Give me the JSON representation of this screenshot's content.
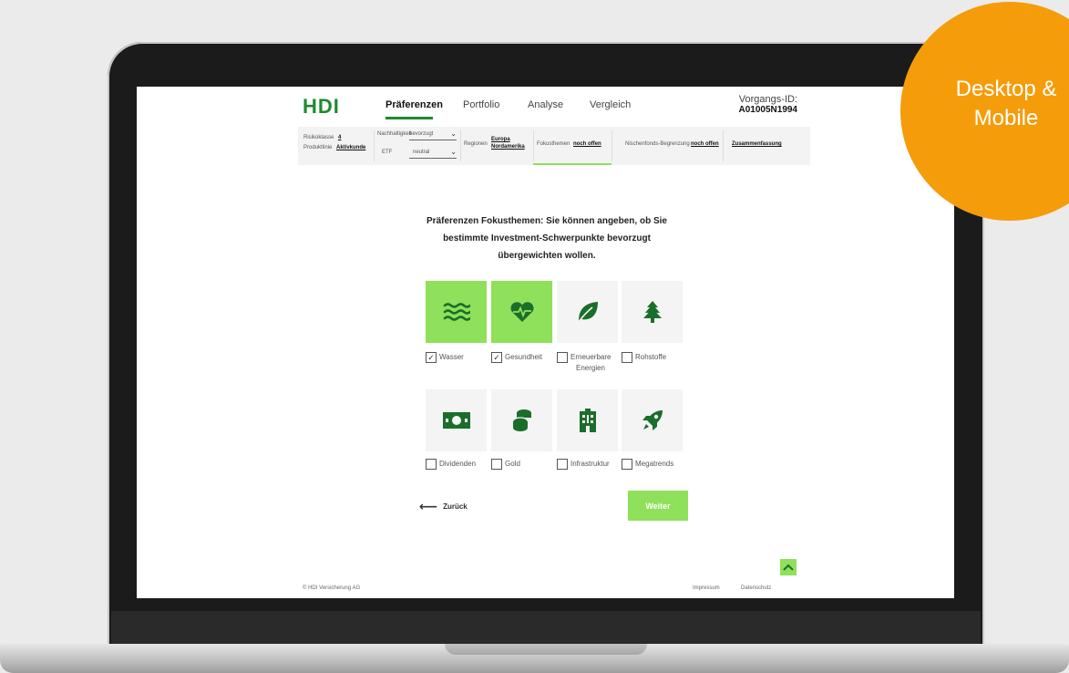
{
  "header": {
    "logo": "HDI",
    "nav": [
      "Präferenzen",
      "Portfolio",
      "Analyse",
      "Vergleich"
    ],
    "vorgang_label": "Vorgangs-ID:",
    "vorgang_id": "A01005N1994"
  },
  "filter_bar": {
    "risikoklasse_label": "Risikoklasse",
    "risikoklasse_value": "4",
    "produktlinie_label": "Produktlinie",
    "produktlinie_value": "Aktivkunde",
    "nachhaltigkeit_label": "Nachhaltigkeit",
    "nachhaltigkeit_value": "bevorzugt",
    "etf_label": "ETF",
    "etf_value": "neutral",
    "regionen_label": "Regionen",
    "regionen_value_1": "Europa",
    "regionen_value_2": "Nordamerika",
    "fokusthemen_label": "Fokusthemen",
    "fokusthemen_value": "noch offen",
    "nischenfonds_label": "Nischenfonds-Begrenzung",
    "nischenfonds_value": "noch offen",
    "zusammenfassung": "Zusammenfassung"
  },
  "question": "Präferenzen Fokusthemen: Sie können angeben, ob Sie bestimmte Investment-Schwerpunkte bevorzugt übergewichten wollen.",
  "options": [
    {
      "label": "Wasser",
      "checked": true,
      "icon": "water-icon"
    },
    {
      "label": "Gesundheit",
      "checked": true,
      "icon": "heart-pulse-icon"
    },
    {
      "label": "Erneuerbare Energien",
      "checked": false,
      "icon": "leaf-icon"
    },
    {
      "label": "Rohstoffe",
      "checked": false,
      "icon": "tree-icon"
    },
    {
      "label": "Dividenden",
      "checked": false,
      "icon": "banknote-icon"
    },
    {
      "label": "Gold",
      "checked": false,
      "icon": "coins-icon"
    },
    {
      "label": "Infrastruktur",
      "checked": false,
      "icon": "building-icon"
    },
    {
      "label": "Megatrends",
      "checked": false,
      "icon": "rocket-icon"
    }
  ],
  "buttons": {
    "back": "Zurück",
    "next": "Weiter"
  },
  "footer": {
    "copyright": "© HDI Versicherung AG",
    "impressum": "Impressum",
    "datenschutz": "Datenschutz"
  },
  "badge": {
    "line1": "Desktop &",
    "line2": "Mobile"
  },
  "colors": {
    "accent_green": "#8fe05a",
    "brand_green": "#1f8a2e",
    "icon_green": "#1b6e2a",
    "badge_orange": "#f59c0b"
  }
}
